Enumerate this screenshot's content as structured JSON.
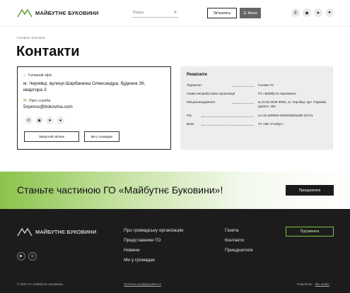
{
  "header": {
    "logo_text": "МАЙБУТНЄ БУКОВИНИ",
    "search_placeholder": "Пошук",
    "donate_label": "Зв'язатись",
    "menu_label": "Меню"
  },
  "breadcrumb": "Головна / Контакти",
  "page_title": "Контакти",
  "contacts": {
    "office_label": "Головний офіс",
    "address": "м. Чернівці, вулиця Шарбанюка Олександра, будинок 39, квартира 3",
    "press_label": "Прес-служба",
    "email": "5npress@bokovina.com",
    "feedback_button": "Зворотній зв'язок",
    "in_community_button": "Ми у громадах"
  },
  "requisites": {
    "title": "Реквізити",
    "rows": [
      {
        "key": "Підписант",
        "value": "Голова ГО"
      },
      {
        "key": "Назва неприбуткової організації",
        "value": "ГО «Майбутнє Буковини»"
      },
      {
        "key": "Місцезнаходження",
        "value": "м.10.03.2026 Ф001, м. Чернівці, вул. Паркова дорога, 15а"
      },
      {
        "key": "Р/р",
        "value": "UA 03 380506 0000026001000 54741"
      },
      {
        "key": "Банк",
        "value": "АТ «КБ «Глобус»"
      }
    ]
  },
  "cta": {
    "text": "Станьте частиною ГО «Майбутнє Буковини»!",
    "button": "Приєднатися"
  },
  "footer": {
    "logo_text": "МАЙБУТНЄ БУКОВИНИ",
    "col1": [
      "Про громадську організацію",
      "Представники ГО",
      "Новини",
      "Ми у громадах"
    ],
    "col2": [
      "Газета",
      "Контакти",
      "Приєднатися"
    ],
    "support_button": "Підтримати",
    "copyright": "© 2026 ГО «Майбутнє Буковини»",
    "privacy": "Політика конфіденційності",
    "developer_label": "Розробник –",
    "developer_name": "Ibis Studio"
  },
  "colors": {
    "accent": "#7cc43a",
    "dark": "#1c1c1c"
  }
}
